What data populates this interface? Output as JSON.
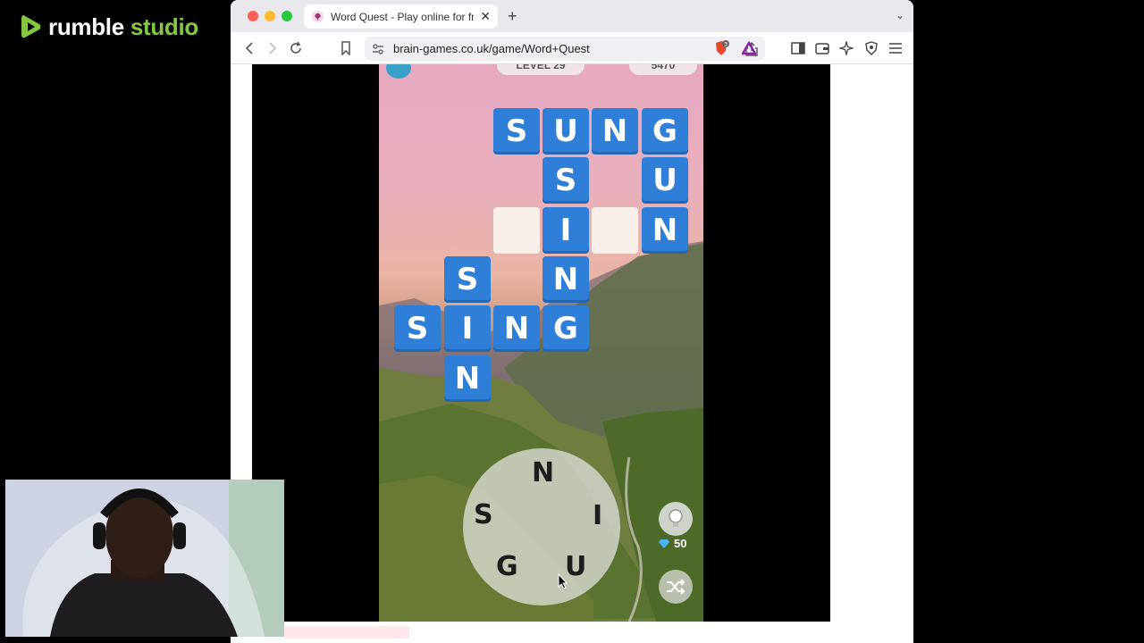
{
  "brand": {
    "name": "rumble",
    "suffix": "studio"
  },
  "browser": {
    "tab_title": "Word Quest - Play online for fr",
    "url": "brain-games.co.uk/game/Word+Quest",
    "shield_count": "3"
  },
  "game": {
    "level_label": "LEVEL 29",
    "coins_label": "5470",
    "tiles": [
      {
        "letter": "S",
        "empty": false
      },
      {
        "letter": "U",
        "empty": false
      },
      {
        "letter": "N",
        "empty": false
      },
      {
        "letter": "G",
        "empty": false
      },
      {
        "letter": "S",
        "empty": false
      },
      {
        "letter": "U",
        "empty": false
      },
      {
        "letter": "",
        "empty": true
      },
      {
        "letter": "I",
        "empty": false
      },
      {
        "letter": "",
        "empty": true
      },
      {
        "letter": "N",
        "empty": false
      },
      {
        "letter": "S",
        "empty": false
      },
      {
        "letter": "N",
        "empty": false
      },
      {
        "letter": "S",
        "empty": false
      },
      {
        "letter": "I",
        "empty": false
      },
      {
        "letter": "N",
        "empty": false
      },
      {
        "letter": "G",
        "empty": false
      },
      {
        "letter": "N",
        "empty": false
      }
    ],
    "wheel_letters": [
      "N",
      "I",
      "U",
      "G",
      "S"
    ],
    "hint_cost": "50"
  },
  "colors": {
    "tile_blue": "#2f7ed8",
    "brand_green": "#85c742"
  }
}
